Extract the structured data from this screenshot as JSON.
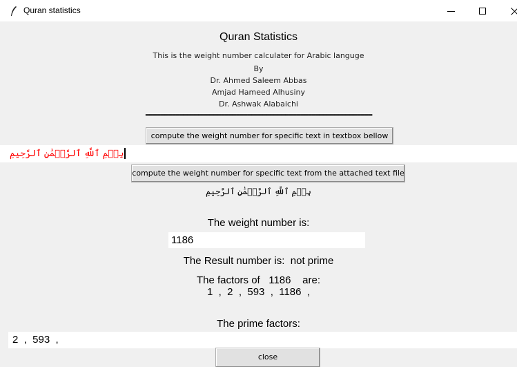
{
  "window": {
    "title": "Quran statistics",
    "icon": "feather-icon",
    "controls": [
      "minimize-icon",
      "maximize-icon",
      "close-icon"
    ]
  },
  "header": {
    "title": "Quran Statistics",
    "description": "This is the weight number calculater for Arabic languge",
    "by": "By",
    "authors": [
      "Dr. Ahmed Saleem Abbas",
      "Amjad Hameed Alhusiny",
      "Dr. Ashwak Alabaichi"
    ],
    "separator": "============================================================"
  },
  "controls": {
    "compute_textbox_button": "compute the weight number for specific text in textbox bellow",
    "compute_file_button": "compute the weight number for specific text from the attached text file",
    "close_button": "close"
  },
  "input": {
    "arabic_text": "بِسۡمِ ٱللَّهِ ٱلرَّحۡمَٰنِ ٱلرَّحِيمِ"
  },
  "file_text": "بِسۡمِ ٱللَّهِ ٱلرَّحۡمَٰنِ ٱلرَّحِيمِ",
  "results": {
    "weight_label": "The weight number is:",
    "weight_value": "1186",
    "result_line": "The Result number is:  not prime",
    "factors_line": "The factors of   1186    are:",
    "factors_list": "1  ,  2  ,  593  ,  1186  ,",
    "prime_label": "The prime factors:",
    "prime_value": "2  ,  593  ,"
  },
  "colors": {
    "window_bg": "#f0f0f0",
    "titlebar_bg": "#ffffff",
    "arabic_input_text": "#ff0000",
    "button_bg": "#e1e1e1"
  }
}
